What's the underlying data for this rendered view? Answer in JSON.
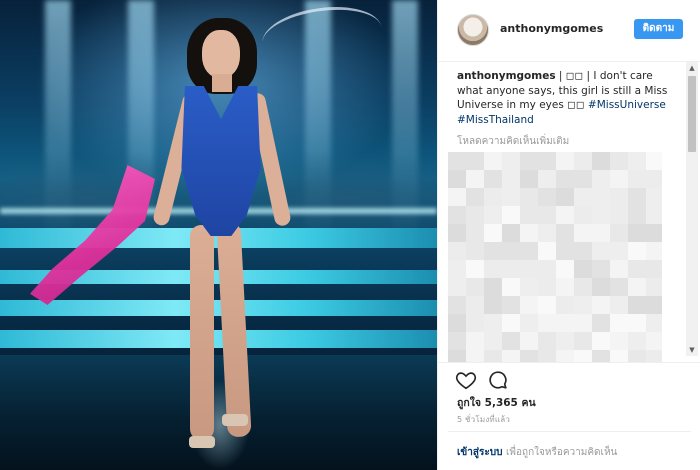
{
  "post": {
    "username": "anthonymgomes",
    "follow_label": "ติดตาม",
    "caption": {
      "author": "anthonymgomes",
      "text": " | ◻◻ | I don't care what anyone says, this girl is still a Miss Universe in my eyes ◻◻ ",
      "hashtag1": "#MissUniverse",
      "hashtag2": "#MissThailand"
    },
    "load_more_label": "โหลดความคิดเห็นเพิ่มเติม",
    "likes_label": "ถูกใจ 5,365 คน",
    "time_label": "5 ชั่วโมงที่แล้ว",
    "login_link": "เข้าสู่ระบบ",
    "login_text": "เพื่อถูกใจหรือความคิดเห็น"
  },
  "icons": {
    "like": "heart-icon",
    "comment": "comment-icon",
    "scroll_up": "arrow-up",
    "scroll_down": "arrow-down"
  },
  "colors": {
    "follow_button": "#3897f0",
    "hashtag": "#003569",
    "muted_text": "#999999",
    "swimsuit": "#2a5dc7",
    "scarf": "#ff62c4"
  }
}
